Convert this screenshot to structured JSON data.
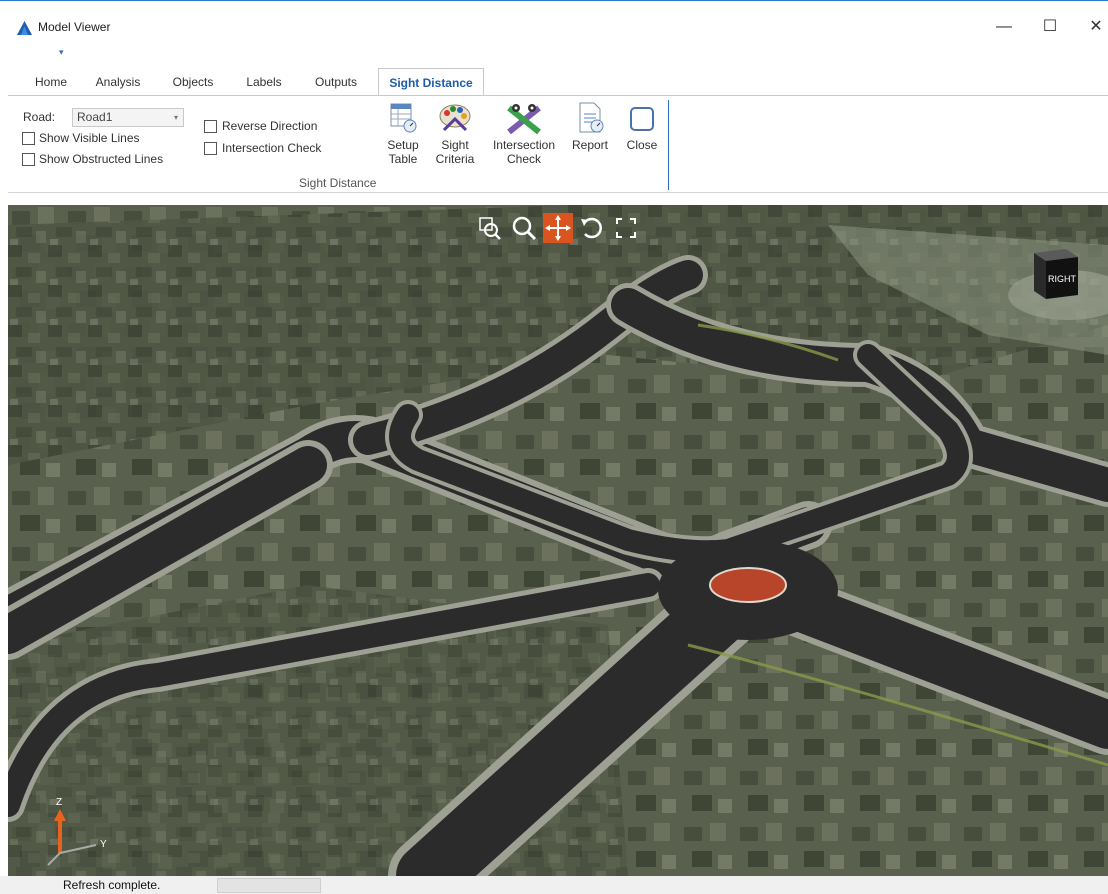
{
  "window": {
    "title": "Model Viewer",
    "qat_glyph": "▾",
    "controls": {
      "minimize": "—",
      "maximize": "☐",
      "close": "✕"
    }
  },
  "tabs": [
    {
      "label": "Home"
    },
    {
      "label": "Analysis"
    },
    {
      "label": "Objects"
    },
    {
      "label": "Labels"
    },
    {
      "label": "Outputs"
    },
    {
      "label": "Sight Distance"
    }
  ],
  "ribbon": {
    "road_label": "Road:",
    "road_value": "Road1",
    "show_visible_lines": "Show Visible Lines",
    "show_obstructed_lines": "Show Obstructed Lines",
    "reverse_direction": "Reverse Direction",
    "intersection_check_checkbox": "Intersection Check",
    "buttons": {
      "setup_table": [
        "Setup",
        "Table"
      ],
      "sight_criteria": [
        "Sight",
        "Criteria"
      ],
      "intersection_check": [
        "Intersection",
        "Check"
      ],
      "report": "Report",
      "close": "Close"
    },
    "group_label": "Sight Distance"
  },
  "viewport": {
    "viewcube_face": "RIGHT",
    "axis_z": "Z",
    "axis_y": "Y",
    "active_tool": "pan",
    "accent_color": "#d9541e"
  },
  "status": {
    "text": "Refresh complete."
  }
}
